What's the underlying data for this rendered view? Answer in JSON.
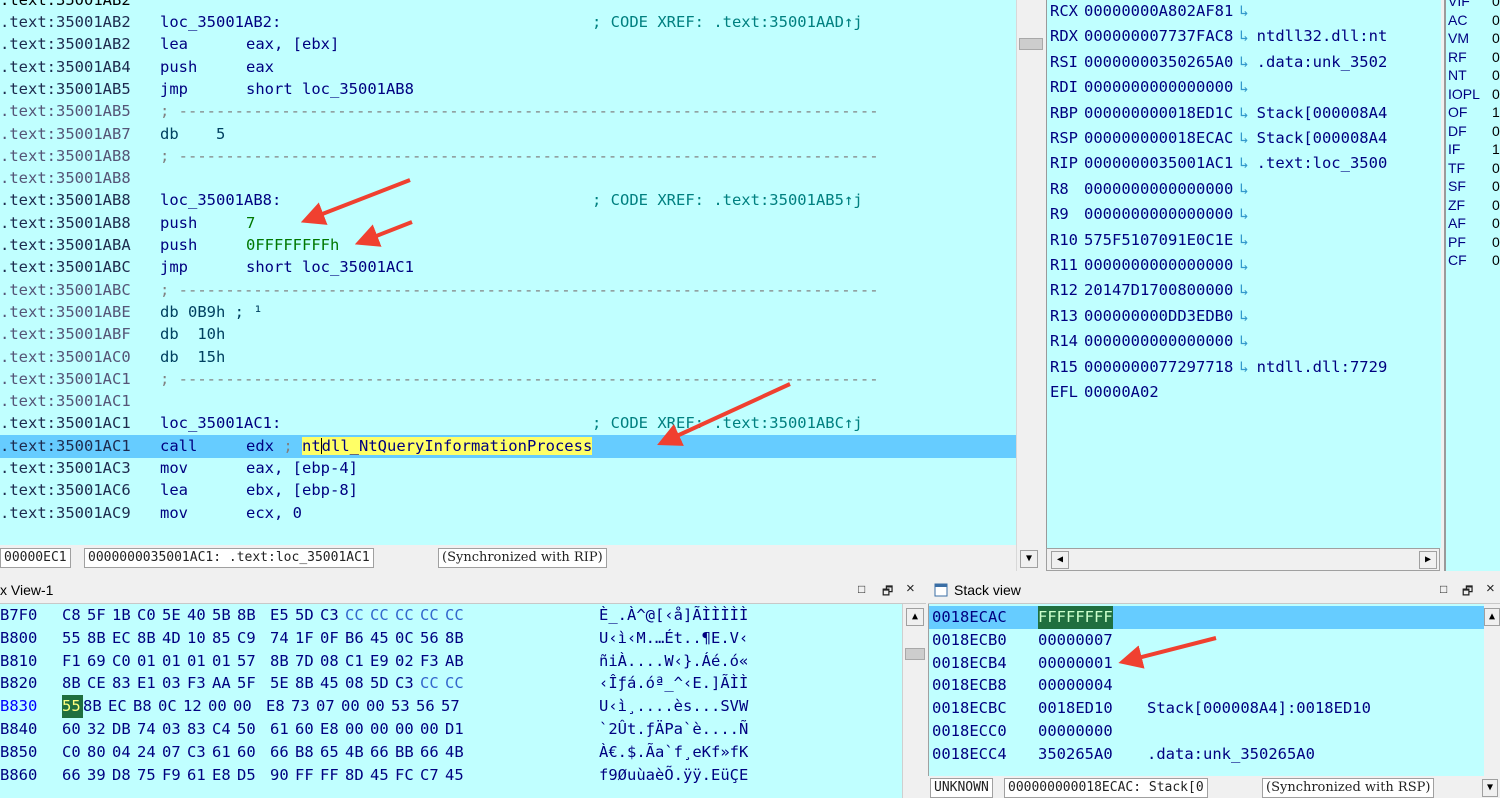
{
  "disasm": {
    "lines": [
      {
        "addr": ".text:35001AB2",
        "type": "label",
        "label": "loc_35001AB2:",
        "xref": "; CODE XREF: .text:35001AAD↑j"
      },
      {
        "addr": ".text:35001AB2",
        "type": "ins",
        "mn": "lea",
        "op": "eax, [ebx]"
      },
      {
        "addr": ".text:35001AB4",
        "type": "ins",
        "mn": "push",
        "op": "eax"
      },
      {
        "addr": ".text:35001AB5",
        "type": "ins",
        "mn": "jmp",
        "op": "short loc_35001AB8"
      },
      {
        "addr": ".text:35001AB5",
        "type": "sep",
        "sep": "; ---------------------------------------------------------------------------"
      },
      {
        "addr": ".text:35001AB7",
        "type": "db",
        "text": "db    5"
      },
      {
        "addr": ".text:35001AB8",
        "type": "sep",
        "sep": "; ---------------------------------------------------------------------------"
      },
      {
        "addr": ".text:35001AB8",
        "type": "blank"
      },
      {
        "addr": ".text:35001AB8",
        "type": "label",
        "label": "loc_35001AB8:",
        "xref": "; CODE XREF: .text:35001AB5↑j"
      },
      {
        "addr": ".text:35001AB8",
        "type": "ins",
        "mn": "push",
        "op": "7",
        "numeric": true
      },
      {
        "addr": ".text:35001ABA",
        "type": "ins",
        "mn": "push",
        "op": "0FFFFFFFFh",
        "numeric": true
      },
      {
        "addr": ".text:35001ABC",
        "type": "ins",
        "mn": "jmp",
        "op": "short loc_35001AC1"
      },
      {
        "addr": ".text:35001ABC",
        "type": "sep",
        "sep": "; ---------------------------------------------------------------------------"
      },
      {
        "addr": ".text:35001ABE",
        "type": "db",
        "text": "db 0B9h ; ¹"
      },
      {
        "addr": ".text:35001ABF",
        "type": "db",
        "text": "db  10h"
      },
      {
        "addr": ".text:35001AC0",
        "type": "db",
        "text": "db  15h"
      },
      {
        "addr": ".text:35001AC1",
        "type": "sep",
        "sep": "; ---------------------------------------------------------------------------"
      },
      {
        "addr": ".text:35001AC1",
        "type": "blank"
      },
      {
        "addr": ".text:35001AC1",
        "type": "label",
        "label": "loc_35001AC1:",
        "xref": "; CODE XREF: .text:35001ABC↑j"
      },
      {
        "addr": ".text:35001AC1",
        "type": "call",
        "mn": "call",
        "op": "edx",
        "comment_pre": "nt",
        "comment_post": "dll_NtQueryInformationProcess"
      },
      {
        "addr": ".text:35001AC3",
        "type": "ins",
        "mn": "mov",
        "op": "eax, [ebp-4]"
      },
      {
        "addr": ".text:35001AC6",
        "type": "ins",
        "mn": "lea",
        "op": "ebx, [ebp-8]"
      },
      {
        "addr": ".text:35001AC9",
        "type": "ins",
        "mn": "mov",
        "op": "ecx, 0"
      }
    ],
    "top_partial": ".text:35001AB2",
    "status": {
      "offset": "00000EC1",
      "location": "0000000035001AC1: .text:loc_35001AC1",
      "sync": "(Synchronized with RIP)"
    }
  },
  "registers": [
    {
      "name": "RCX",
      "value": "00000000A802AF81",
      "desc": ""
    },
    {
      "name": "RDX",
      "value": "000000007737FAC8",
      "desc": "ntdll32.dll:nt"
    },
    {
      "name": "RSI",
      "value": "00000000350265A0",
      "desc": ".data:unk_3502"
    },
    {
      "name": "RDI",
      "value": "0000000000000000",
      "desc": ""
    },
    {
      "name": "RBP",
      "value": "000000000018ED1C",
      "desc": "Stack[000008A4"
    },
    {
      "name": "RSP",
      "value": "000000000018ECAC",
      "desc": "Stack[000008A4"
    },
    {
      "name": "RIP",
      "value": "0000000035001AC1",
      "desc": ".text:loc_3500"
    },
    {
      "name": "R8",
      "value": "0000000000000000",
      "desc": ""
    },
    {
      "name": "R9",
      "value": "0000000000000000",
      "desc": ""
    },
    {
      "name": "R10",
      "value": "575F5107091E0C1E",
      "desc": ""
    },
    {
      "name": "R11",
      "value": "0000000000000000",
      "desc": ""
    },
    {
      "name": "R12",
      "value": "20147D1700800000",
      "desc": ""
    },
    {
      "name": "R13",
      "value": "000000000DD3EDB0",
      "desc": ""
    },
    {
      "name": "R14",
      "value": "0000000000000000",
      "desc": ""
    },
    {
      "name": "R15",
      "value": "0000000077297718",
      "desc": "ntdll.dll:7729"
    },
    {
      "name": "EFL",
      "value": "00000A02",
      "desc": "",
      "no_arrow": true
    }
  ],
  "register_arrow": "↳",
  "flags": [
    {
      "name": "VIF",
      "value": "0"
    },
    {
      "name": "AC",
      "value": "0"
    },
    {
      "name": "VM",
      "value": "0"
    },
    {
      "name": "RF",
      "value": "0"
    },
    {
      "name": "NT",
      "value": "0"
    },
    {
      "name": "IOPL",
      "value": "0"
    },
    {
      "name": "OF",
      "value": "1"
    },
    {
      "name": "DF",
      "value": "0"
    },
    {
      "name": "IF",
      "value": "1"
    },
    {
      "name": "TF",
      "value": "0"
    },
    {
      "name": "SF",
      "value": "0"
    },
    {
      "name": "ZF",
      "value": "0"
    },
    {
      "name": "AF",
      "value": "0"
    },
    {
      "name": "PF",
      "value": "0"
    },
    {
      "name": "CF",
      "value": "0"
    }
  ],
  "hex_view": {
    "title": "x View-1",
    "rows": [
      {
        "addr": "B7F0",
        "bytes": [
          "C8",
          "5F",
          "1B",
          "C0",
          "5E",
          "40",
          "5B",
          "8B",
          "E5",
          "5D",
          "C3",
          "CC",
          "CC",
          "CC",
          "CC",
          "CC"
        ],
        "ascii": "È_.À^@[‹å]ÃÌÌÌÌÌ"
      },
      {
        "addr": "B800",
        "bytes": [
          "55",
          "8B",
          "EC",
          "8B",
          "4D",
          "10",
          "85",
          "C9",
          "74",
          "1F",
          "0F",
          "B6",
          "45",
          "0C",
          "56",
          "8B"
        ],
        "ascii": "U‹ì‹M.…Ét..¶E.V‹"
      },
      {
        "addr": "B810",
        "bytes": [
          "F1",
          "69",
          "C0",
          "01",
          "01",
          "01",
          "01",
          "57",
          "8B",
          "7D",
          "08",
          "C1",
          "E9",
          "02",
          "F3",
          "AB"
        ],
        "ascii": "ñiÀ....W‹}.Áé.ó«"
      },
      {
        "addr": "B820",
        "bytes": [
          "8B",
          "CE",
          "83",
          "E1",
          "03",
          "F3",
          "AA",
          "5F",
          "5E",
          "8B",
          "45",
          "08",
          "5D",
          "C3",
          "CC",
          "CC"
        ],
        "ascii": "‹Îƒá.óª_^‹E.]ÃÌÌ"
      },
      {
        "addr": "B830",
        "bytes": [
          "55",
          "8B",
          "EC",
          "B8",
          "0C",
          "12",
          "00",
          "00",
          "E8",
          "73",
          "07",
          "00",
          "00",
          "53",
          "56",
          "57"
        ],
        "ascii": "U‹ì¸....ès...SVW",
        "selected": true
      },
      {
        "addr": "B840",
        "bytes": [
          "60",
          "32",
          "DB",
          "74",
          "03",
          "83",
          "C4",
          "50",
          "61",
          "60",
          "E8",
          "00",
          "00",
          "00",
          "00",
          "D1"
        ],
        "ascii": "`2Ût.ƒÄPa`è....Ñ"
      },
      {
        "addr": "B850",
        "bytes": [
          "C0",
          "80",
          "04",
          "24",
          "07",
          "C3",
          "61",
          "60",
          "66",
          "B8",
          "65",
          "4B",
          "66",
          "BB",
          "66",
          "4B"
        ],
        "ascii": "À€.$.Ãa`f¸eKf»fK"
      },
      {
        "addr": "B860",
        "bytes": [
          "66",
          "39",
          "D8",
          "75",
          "F9",
          "61",
          "E8",
          "D5",
          "90",
          "FF",
          "FF",
          "8D",
          "45",
          "FC",
          "C7",
          "45"
        ],
        "ascii": "f9ØuùaèÕ.ÿÿ.EüÇE"
      }
    ],
    "buttons": {
      "minimize": "□",
      "float": "🗗",
      "close": "×"
    }
  },
  "stack_view": {
    "title": "Stack view",
    "rows": [
      {
        "addr": "0018ECAC",
        "value": "FFFFFFFF",
        "desc": ""
      },
      {
        "addr": "0018ECB0",
        "value": "00000007",
        "desc": ""
      },
      {
        "addr": "0018ECB4",
        "value": "00000001",
        "desc": ""
      },
      {
        "addr": "0018ECB8",
        "value": "00000004",
        "desc": ""
      },
      {
        "addr": "0018ECBC",
        "value": "0018ED10",
        "desc": "Stack[000008A4]:0018ED10"
      },
      {
        "addr": "0018ECC0",
        "value": "00000000",
        "desc": ""
      },
      {
        "addr": "0018ECC4",
        "value": "350265A0",
        "desc": ".data:unk_350265A0"
      }
    ],
    "status": {
      "kind": "UNKNOWN",
      "location": "000000000018ECAC: Stack[0",
      "sync": "(Synchronized with RSP)"
    },
    "buttons": {
      "minimize": "□",
      "float": "🗗",
      "close": "×"
    }
  },
  "colors": {
    "pane_bg": "#c0ffff",
    "highlight": "#66ccff",
    "annotation_arrow": "#f04030"
  }
}
